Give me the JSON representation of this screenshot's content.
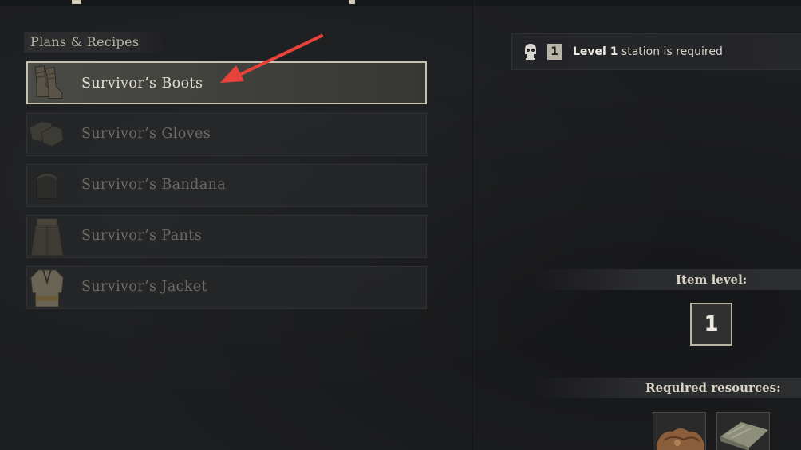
{
  "recipes_panel": {
    "header": "Plans & Recipes",
    "items": [
      {
        "label": "Survivor’s Boots",
        "icon": "boots-icon",
        "selected": true
      },
      {
        "label": "Survivor’s Gloves",
        "icon": "gloves-icon",
        "selected": false
      },
      {
        "label": "Survivor’s Bandana",
        "icon": "bandana-icon",
        "selected": false
      },
      {
        "label": "Survivor’s Pants",
        "icon": "pants-icon",
        "selected": false
      },
      {
        "label": "Survivor’s Jacket",
        "icon": "jacket-icon",
        "selected": false
      }
    ]
  },
  "details_panel": {
    "station": {
      "badge_number": "1",
      "level_text": "Level 1",
      "suffix_text": "station is required",
      "icon": "skull-icon"
    },
    "item_level": {
      "header": "Item level:",
      "value": "1"
    },
    "resources": {
      "header": "Required resources:",
      "items": [
        {
          "icon": "leather-hide-icon"
        },
        {
          "icon": "cloth-icon"
        }
      ]
    }
  },
  "colors": {
    "background": "#1d1e20",
    "selected_border": "#c7c2b0",
    "annotation_arrow": "#e8433a"
  }
}
